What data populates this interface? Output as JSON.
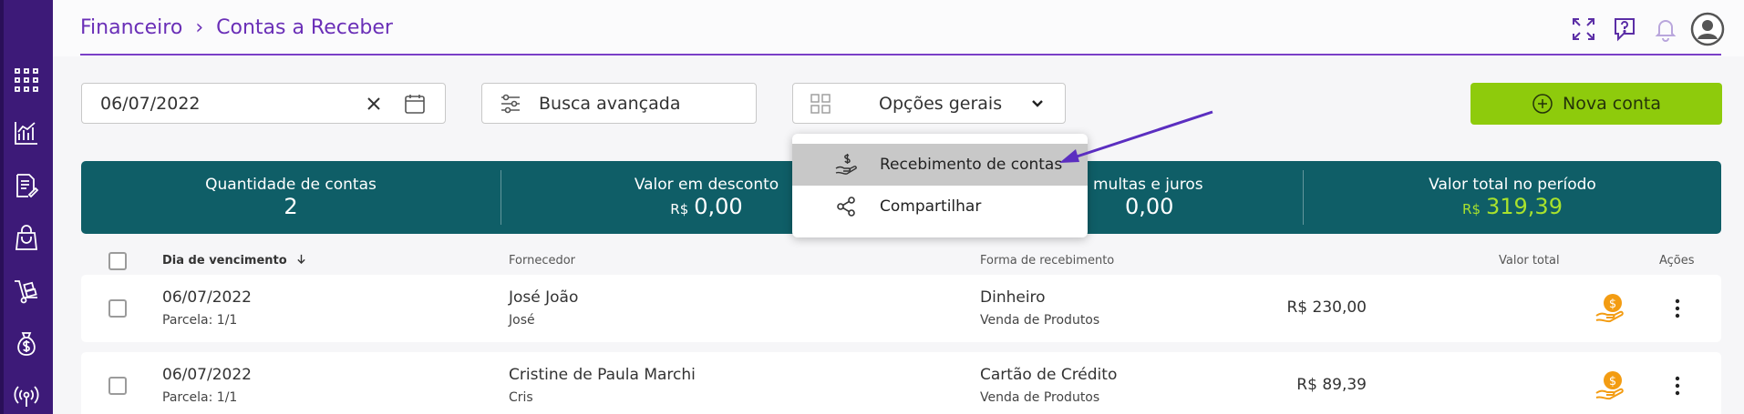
{
  "breadcrumb": {
    "parent": "Financeiro",
    "separator": "›",
    "current": "Contas a Receber"
  },
  "filters": {
    "date_value": "06/07/2022",
    "advanced_search_label": "Busca avançada",
    "general_options_label": "Opções gerais"
  },
  "new_account_label": "Nova conta",
  "dropdown": {
    "items": [
      {
        "label": "Recebimento de contas"
      },
      {
        "label": "Compartilhar"
      }
    ]
  },
  "stats": [
    {
      "label": "Quantidade de contas",
      "value": "2"
    },
    {
      "label": "Valor em desconto",
      "currency": "R$",
      "value": "0,00"
    },
    {
      "label": "multas e juros",
      "value": "0,00"
    },
    {
      "label": "Valor total no período",
      "currency": "R$",
      "value": "319,39"
    }
  ],
  "table": {
    "headers": {
      "due_date": "Dia de vencimento",
      "supplier": "Fornecedor",
      "payment_method": "Forma de recebimento",
      "total": "Valor total",
      "actions": "Ações"
    },
    "rows": [
      {
        "date": "06/07/2022",
        "installment": "Parcela: 1/1",
        "supplier": "José João",
        "supplier_sub": "José",
        "method": "Dinheiro",
        "method_sub": "Venda de Produtos",
        "total": "R$ 230,00"
      },
      {
        "date": "06/07/2022",
        "installment": "Parcela: 1/1",
        "supplier": "Cristine de Paula Marchi",
        "supplier_sub": "Cris",
        "method": "Cartão de Crédito",
        "method_sub": "Venda de Produtos",
        "total": "R$ 89,39"
      }
    ]
  },
  "colors": {
    "sidebar": "#3d1a78",
    "accent_purple": "#6a2fb7",
    "stats_bg": "#0f5e67",
    "new_button": "#8ecb0c",
    "highlight_value": "#a8e22d",
    "money_icon": "#f39c12"
  },
  "icons": {
    "sidebar": [
      "apps-grid-icon",
      "chart-icon",
      "document-edit-icon",
      "shopping-bag-icon",
      "hand-truck-icon",
      "money-bag-icon",
      "broadcast-icon"
    ],
    "top": [
      "fullscreen-icon",
      "help-chat-icon",
      "bell-icon",
      "user-avatar-icon"
    ]
  }
}
